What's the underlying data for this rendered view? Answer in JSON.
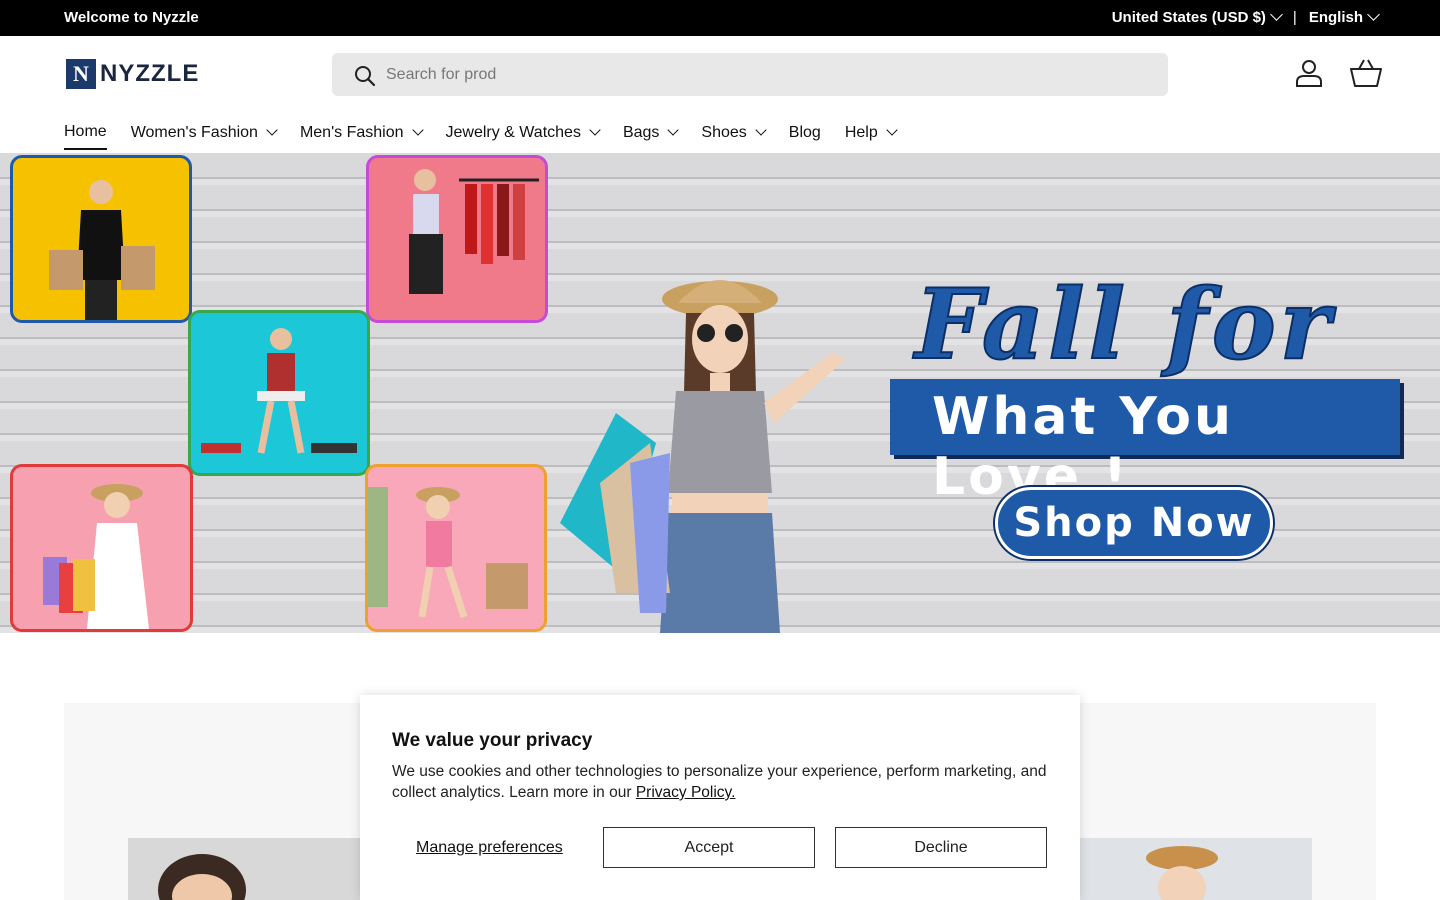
{
  "topbar": {
    "welcome": "Welcome to Nyzzle",
    "currency": "United States (USD $)",
    "separator": "|",
    "language": "English"
  },
  "header": {
    "logo_text": "NYZZLE",
    "logo_mark": "N",
    "search": {
      "value": "",
      "placeholder": "Search for prod"
    },
    "icons": [
      "search-icon",
      "account-icon",
      "cart-icon"
    ]
  },
  "nav": {
    "items": [
      {
        "label": "Home",
        "active": true,
        "dropdown": false
      },
      {
        "label": "Women's Fashion",
        "dropdown": true
      },
      {
        "label": "Men's Fashion",
        "dropdown": true
      },
      {
        "label": "Jewelry & Watches",
        "dropdown": true
      },
      {
        "label": "Bags",
        "dropdown": true
      },
      {
        "label": "Shoes",
        "dropdown": true
      },
      {
        "label": "Blog",
        "dropdown": false
      },
      {
        "label": "Help",
        "dropdown": true
      }
    ]
  },
  "hero": {
    "headline_script": "Fall for",
    "headline_band": "What You Love !",
    "cta": "Shop Now",
    "tile_border_colors": [
      "#1e5aa8",
      "#c44ad8",
      "#3aa84a",
      "#e03a3a",
      "#f0a030"
    ],
    "tile_bg_colors": [
      "#f6c200",
      "#f07a8a",
      "#1cc7d8",
      "#f7a0b0",
      "#f8a8b8"
    ],
    "accent": "#1e5aa8"
  },
  "cookie": {
    "title": "We value your privacy",
    "body": "We use cookies and other technologies to personalize your experience, perform marketing, and collect analytics. Learn more in our",
    "link": "Privacy Policy.",
    "manage": "Manage preferences",
    "accept": "Accept",
    "decline": "Decline"
  }
}
